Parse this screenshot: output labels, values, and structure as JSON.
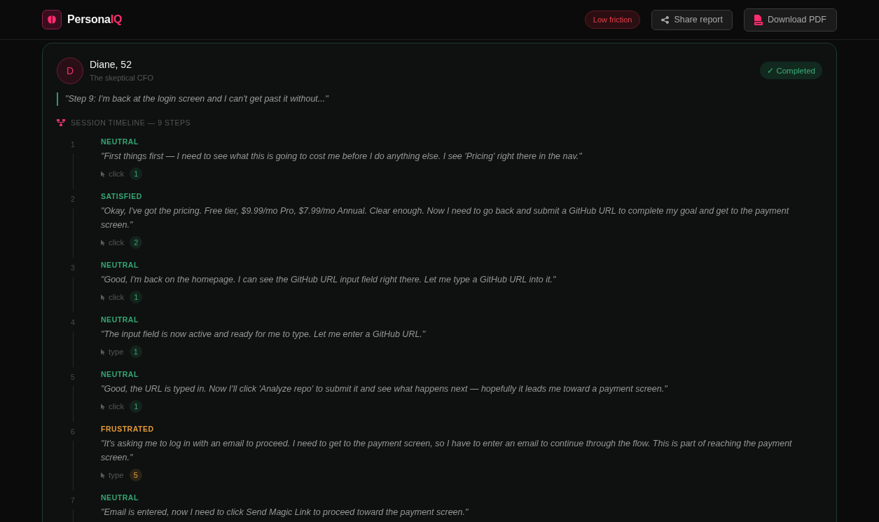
{
  "header": {
    "brand": {
      "name": "Persona",
      "accent": "IQ"
    },
    "friction_badge": "Low friction",
    "buttons": [
      {
        "label": "Share report",
        "kind": "share"
      },
      {
        "label": "Download PDF",
        "kind": "pdf"
      }
    ]
  },
  "persona": {
    "initial": "D",
    "name": "Diane, 52",
    "subtitle": "The skeptical CFO",
    "status": "✓ Completed",
    "quote": "\"Step 9: I'm back at the login screen and I can't get past it without...\""
  },
  "timeline": {
    "heading": "SESSION TIMELINE — 9 STEPS",
    "steps": [
      {
        "number": "1",
        "mood": "NEUTRAL",
        "color": "#34a873",
        "quote": "\"First things first — I need to see what this is going to cost me before I do anything else. I see 'Pricing' right there in the nav.\"",
        "actions": [
          {
            "type": "click",
            "count": "1"
          }
        ]
      },
      {
        "number": "2",
        "mood": "SATISFIED",
        "color": "#34a873",
        "quote": "\"Okay, I've got the pricing. Free tier, $9.99/mo Pro, $7.99/mo Annual. Clear enough. Now I need to go back and submit a GitHub URL to complete my goal and get to the payment screen.\"",
        "actions": [
          {
            "type": "click",
            "count": "2"
          }
        ]
      },
      {
        "number": "3",
        "mood": "NEUTRAL",
        "color": "#34a873",
        "quote": "\"Good, I'm back on the homepage. I can see the GitHub URL input field right there. Let me type a GitHub URL into it.\"",
        "actions": [
          {
            "type": "click",
            "count": "1"
          }
        ]
      },
      {
        "number": "4",
        "mood": "NEUTRAL",
        "color": "#34a873",
        "quote": "\"The input field is now active and ready for me to type. Let me enter a GitHub URL.\"",
        "actions": [
          {
            "type": "type",
            "count": "1"
          }
        ]
      },
      {
        "number": "5",
        "mood": "NEUTRAL",
        "color": "#34a873",
        "quote": "\"Good, the URL is typed in. Now I'll click 'Analyze repo' to submit it and see what happens next — hopefully it leads me toward a payment screen.\"",
        "actions": [
          {
            "type": "click",
            "count": "1"
          }
        ]
      },
      {
        "number": "6",
        "mood": "FRUSTRATED",
        "color": "#e39a3b",
        "quote": "\"It's asking me to log in with an email to proceed. I need to get to the payment screen, so I have to enter an email to continue through the flow. This is part of reaching the payment screen.\"",
        "actions": [
          {
            "type": "type",
            "count": "5"
          }
        ]
      },
      {
        "number": "7",
        "mood": "NEUTRAL",
        "color": "#34a873",
        "quote": "\"Email is entered, now I need to click Send Magic Link to proceed toward the payment screen.\""
      }
    ]
  }
}
